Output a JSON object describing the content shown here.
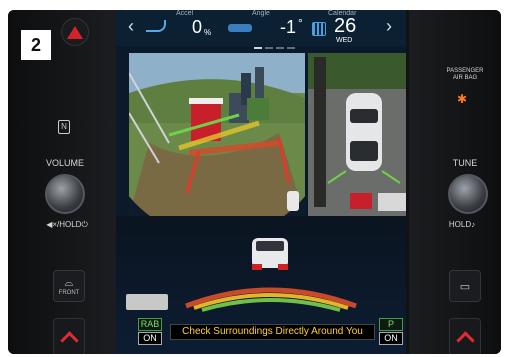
{
  "figure_number": "2",
  "header": {
    "eco_label": "Accel",
    "eco_value": "0",
    "eco_unit": "%",
    "angle_label": "Angle",
    "angle_value": "-1",
    "angle_unit": "°",
    "calendar_label": "Calendar",
    "day_number": "26",
    "weekday": "WED"
  },
  "left_panel": {
    "volume_label": "VOLUME",
    "mute_power_label": "◀×/HOLD⏻",
    "front_button_label": "FRONT"
  },
  "right_panel": {
    "airbag_label_line1": "PASSENGER",
    "airbag_label_line2": "AIR BAG",
    "tune_label": "TUNE",
    "hold_label": "HOLD♪"
  },
  "camera": {
    "rab_label": "RAB",
    "rab_state": "ON",
    "warning_text": "Check Surroundings Directly Around You",
    "parking_label": "P",
    "parking_state": "ON"
  },
  "colors": {
    "accent_red": "#e02b35",
    "warning_yellow": "#ffd13a",
    "screen_blue": "#0c2033",
    "airbag_orange": "#ff7a1a",
    "indicator_green": "#7ee06c"
  },
  "icons": {
    "hazard": "hazard-triangle-icon",
    "nfc": "nfc-icon",
    "prev": "chevron-left-icon",
    "next": "chevron-right-icon",
    "calendar": "calendar-icon",
    "front_defrost": "front-defrost-icon",
    "rear_defrost": "rear-defrost-icon"
  }
}
